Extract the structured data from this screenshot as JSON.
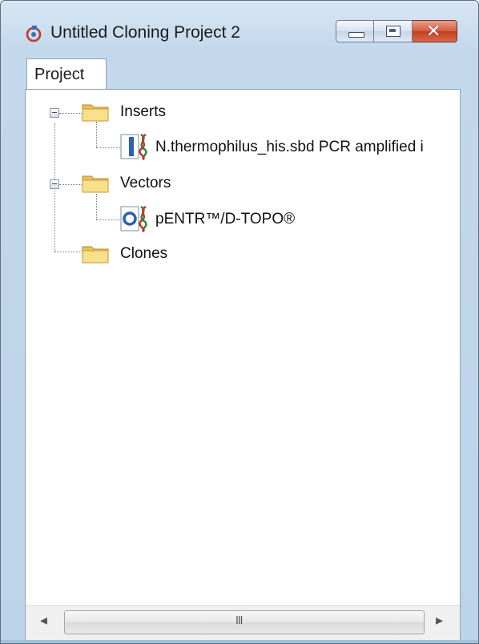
{
  "window": {
    "title": "Untitled Cloning Project 2",
    "close_symbol": "✕",
    "colors": {
      "frame": "#c4d8ec",
      "close": "#c23e1e",
      "panel": "#ffffff"
    }
  },
  "tabs": [
    {
      "label": "Project",
      "selected": true
    }
  ],
  "tree": {
    "nodes": [
      {
        "label": "Inserts",
        "icon": "folder-icon",
        "expanded": true
      },
      {
        "label": "N.thermophilus_his.sbd PCR amplified i",
        "icon": "linear-sequence-icon"
      },
      {
        "label": "Vectors",
        "icon": "folder-icon",
        "expanded": true
      },
      {
        "label": "pENTR™/D-TOPO®",
        "icon": "circular-vector-icon"
      },
      {
        "label": "Clones",
        "icon": "folder-icon",
        "expanded": false
      }
    ]
  },
  "scrollbar": {
    "left_arrow": "◂",
    "right_arrow": "▸",
    "grip": "III"
  }
}
